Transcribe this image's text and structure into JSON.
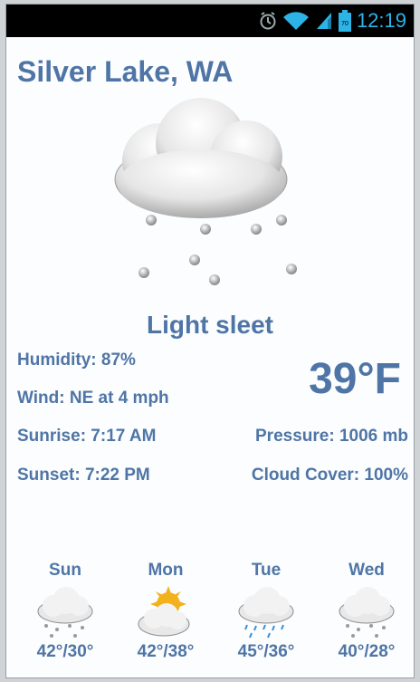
{
  "status_bar": {
    "time": "12:19",
    "battery_level": "70",
    "icons": [
      "alarm-icon",
      "wifi-icon",
      "signal-icon",
      "battery-icon"
    ]
  },
  "location": "Silver Lake, WA",
  "current": {
    "condition": "Light sleet",
    "icon": "sleet-cloud-icon",
    "temperature": "39°F",
    "humidity": "Humidity: 87%",
    "wind": "Wind: NE at 4 mph",
    "sunrise": "Sunrise: 7:17 AM",
    "sunset": "Sunset: 7:22 PM",
    "pressure": "Pressure: 1006 mb",
    "cloud_cover": "Cloud Cover: 100%"
  },
  "forecast": [
    {
      "day": "Sun",
      "temps": "42°/30°",
      "icon": "sleet-cloud-icon"
    },
    {
      "day": "Mon",
      "temps": "42°/38°",
      "icon": "sun-cloud-icon"
    },
    {
      "day": "Tue",
      "temps": "45°/36°",
      "icon": "rain-cloud-icon"
    },
    {
      "day": "Wed",
      "temps": "40°/28°",
      "icon": "sleet-cloud-icon"
    }
  ],
  "colors": {
    "accent": "#4f75a6",
    "clock": "#2cb4e7",
    "status_bar": "#000000"
  }
}
